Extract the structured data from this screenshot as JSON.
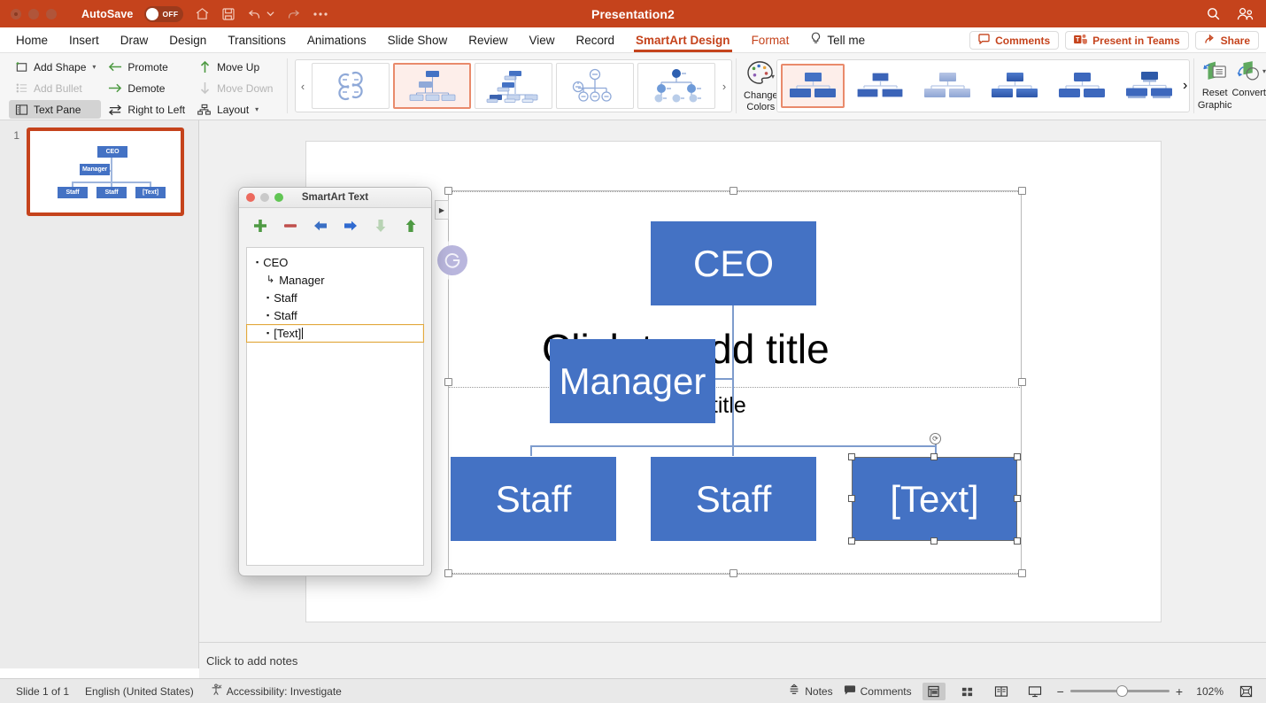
{
  "titlebar": {
    "autosave_label": "AutoSave",
    "autosave_state": "OFF",
    "document_title": "Presentation2",
    "icons": [
      "home-icon",
      "save-icon",
      "undo-icon",
      "undo-dropdown-icon",
      "redo-icon",
      "more-icon",
      "search-icon",
      "account-icon"
    ]
  },
  "tabs": [
    {
      "label": "Home",
      "state": "normal"
    },
    {
      "label": "Insert",
      "state": "normal"
    },
    {
      "label": "Draw",
      "state": "normal"
    },
    {
      "label": "Design",
      "state": "normal"
    },
    {
      "label": "Transitions",
      "state": "normal"
    },
    {
      "label": "Animations",
      "state": "normal"
    },
    {
      "label": "Slide Show",
      "state": "normal"
    },
    {
      "label": "Review",
      "state": "normal"
    },
    {
      "label": "View",
      "state": "normal"
    },
    {
      "label": "Record",
      "state": "normal"
    },
    {
      "label": "SmartArt Design",
      "state": "active"
    },
    {
      "label": "Format",
      "state": "accent"
    }
  ],
  "tellme": {
    "label": "Tell me",
    "icon": "lightbulb-icon"
  },
  "ribbon_actions": [
    {
      "label": "Comments",
      "icon": "comment-icon"
    },
    {
      "label": "Present in Teams",
      "icon": "teams-icon"
    },
    {
      "label": "Share",
      "icon": "share-icon"
    }
  ],
  "ribbon": {
    "commands": [
      {
        "label": "Add Shape",
        "icon": "add-shape-icon",
        "enabled": true,
        "dropdown": true
      },
      {
        "label": "Add Bullet",
        "icon": "add-bullet-icon",
        "enabled": false,
        "dropdown": false
      },
      {
        "label": "Text Pane",
        "icon": "text-pane-icon",
        "enabled": true,
        "selected": true,
        "dropdown": false
      },
      {
        "label": "Promote",
        "icon": "arrow-left-icon",
        "enabled": true,
        "dropdown": false
      },
      {
        "label": "Demote",
        "icon": "arrow-right-icon",
        "enabled": true,
        "dropdown": false
      },
      {
        "label": "Right to Left",
        "icon": "swap-arrows-icon",
        "enabled": true,
        "dropdown": false
      },
      {
        "label": "Move Up",
        "icon": "arrow-up-icon",
        "enabled": true,
        "dropdown": false
      },
      {
        "label": "Move Down",
        "icon": "arrow-down-icon",
        "enabled": false,
        "dropdown": false
      },
      {
        "label": "Layout",
        "icon": "layout-icon",
        "enabled": true,
        "dropdown": true
      }
    ],
    "layout_gallery": {
      "prev_icon": "chevron-left-icon",
      "next_icon": "chevron-right-icon",
      "selected_index": 1,
      "items": [
        "cycle-layout",
        "organization-chart-layout",
        "name-and-title-org-chart-layout",
        "half-circle-org-layout",
        "circle-picture-hierarchy-layout"
      ]
    },
    "change_colors": {
      "line1": "Change",
      "line2": "Colors",
      "icon": "palette-icon",
      "dropdown": true
    },
    "styles_gallery": {
      "selected_index": 0,
      "next_icon": "chevron-right-icon",
      "items": [
        "style-simple-fill",
        "style-white-outline",
        "style-subtle-effect",
        "style-moderate-effect",
        "style-intense-effect",
        "style-polished"
      ]
    },
    "reset_graphic": {
      "line1": "Reset",
      "line2": "Graphic",
      "icon": "reset-graphic-icon"
    },
    "convert": {
      "line1": "Convert",
      "line2": "",
      "icon": "convert-icon",
      "dropdown": true
    }
  },
  "slide_panel": {
    "slide_number": "1",
    "thumbnail_nodes": [
      "CEO",
      "Manager",
      "Staff",
      "Staff",
      "[Text]"
    ]
  },
  "slide": {
    "title_placeholder": "Click to add title",
    "subtitle_placeholder": "Click to add subtitle",
    "smartart": {
      "accent_color": "#4472c4",
      "connector_color": "#7e9ccd",
      "nodes": [
        {
          "label": "CEO",
          "level": 1,
          "selected": false
        },
        {
          "label": "Manager",
          "level": 2,
          "selected": false
        },
        {
          "label": "Staff",
          "level": 3,
          "selected": false
        },
        {
          "label": "Staff",
          "level": 3,
          "selected": false
        },
        {
          "label": "[Text]",
          "level": 3,
          "selected": true
        }
      ]
    },
    "grammarly_badge": "grammarly-icon",
    "collapse_tab_icon": "expand-right-icon"
  },
  "notes": {
    "placeholder": "Click to add notes"
  },
  "text_pane": {
    "window_title": "SmartArt Text",
    "toolbar": [
      {
        "name": "add-shape-plus-button",
        "icon": "plus-icon",
        "color": "#4e9a43",
        "enabled": true
      },
      {
        "name": "remove-shape-button",
        "icon": "minus-icon",
        "color": "#c0504d",
        "enabled": true
      },
      {
        "name": "promote-button",
        "icon": "left-arrow-icon",
        "color": "#3a6fc4",
        "enabled": true
      },
      {
        "name": "demote-button",
        "icon": "right-arrow-icon",
        "color": "#2f6ad0",
        "enabled": true
      },
      {
        "name": "move-down-button",
        "icon": "down-arrow-icon",
        "color": "#b8d3b4",
        "enabled": false
      },
      {
        "name": "move-up-button",
        "icon": "up-arrow-icon",
        "color": "#4e9a43",
        "enabled": true
      }
    ],
    "items": [
      {
        "text": "CEO",
        "level": 1,
        "bullet": "square",
        "editing": false
      },
      {
        "text": "Manager",
        "level": 2,
        "bullet": "elbow",
        "editing": false
      },
      {
        "text": "Staff",
        "level": 3,
        "bullet": "square",
        "editing": false
      },
      {
        "text": "Staff",
        "level": 3,
        "bullet": "square",
        "editing": false
      },
      {
        "text": "[Text]",
        "level": 3,
        "bullet": "square",
        "editing": true
      }
    ]
  },
  "status_bar": {
    "slide_count": "Slide 1 of 1",
    "language": "English (United States)",
    "accessibility": "Accessibility: Investigate",
    "accessibility_icon": "accessibility-icon",
    "notes_label": "Notes",
    "comments_label": "Comments",
    "views": [
      {
        "name": "normal-view",
        "icon": "normal-view-icon",
        "active": true
      },
      {
        "name": "slide-sorter-view",
        "icon": "slide-sorter-icon",
        "active": false
      },
      {
        "name": "reading-view",
        "icon": "reading-view-icon",
        "active": false
      },
      {
        "name": "slideshow-view",
        "icon": "slideshow-icon",
        "active": false
      }
    ],
    "zoom_out": "−",
    "zoom_in": "+",
    "zoom_level": "102%",
    "fit_icon": "fit-slide-icon"
  }
}
